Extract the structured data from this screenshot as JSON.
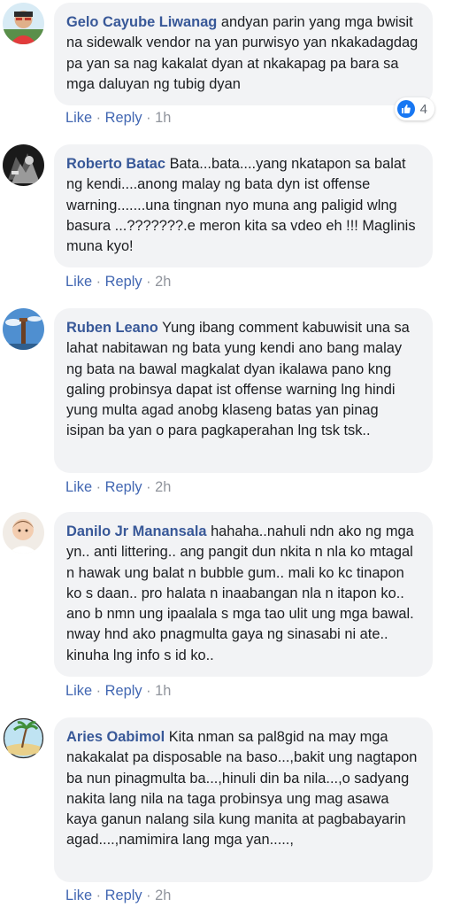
{
  "comments": [
    {
      "author": "Gelo Cayube Liwanag",
      "text": "andyan parin yang mga bwisit na sidewalk vendor na yan purwisyo yan nkakadagdag pa yan sa nag kakalat dyan at nkakapag pa bara sa mga daluyan ng tubig dyan",
      "like_label": "Like",
      "reply_label": "Reply",
      "time": "1h",
      "separator": "·",
      "reaction_count": "4",
      "reaction_icon": "thumbs-up-icon"
    },
    {
      "author": "Roberto Batac",
      "text": "Bata...bata....yang nkatapon sa balat ng kendi....anong malay ng bata dyn ist offense warning.......una tingnan nyo muna ang paligid wlng basura ...???????.e meron kita sa vdeo eh !!! Maglinis muna kyo!",
      "like_label": "Like",
      "reply_label": "Reply",
      "time": "2h",
      "separator": "·"
    },
    {
      "author": "Ruben Leano",
      "text": "Yung ibang comment kabuwisit una sa lahat nabitawan ng bata yung kendi ano bang malay ng bata na bawal magkalat dyan ikalawa pano kng galing probinsya dapat ist offense warning lng hindi yung multa agad anobg klaseng batas yan pinag isipan ba yan o para pagkaperahan lng tsk tsk..",
      "like_label": "Like",
      "reply_label": "Reply",
      "time": "2h",
      "separator": "·"
    },
    {
      "author": "Danilo Jr Manansala",
      "text": "hahaha..nahuli ndn ako ng mga yn.. anti littering.. ang pangit dun nkita n nla ko mtagal n hawak ung balat n bubble gum.. mali ko kc tinapon ko s daan.. pro halata n inaabangan nla n itapon ko.. ano b nmn ung ipaalala s mga tao ulit ung mga bawal. nway hnd ako pnagmulta gaya ng sinasabi ni ate.. kinuha lng info s id ko..",
      "like_label": "Like",
      "reply_label": "Reply",
      "time": "1h",
      "separator": "·"
    },
    {
      "author": "Aries Oabimol",
      "text": "Kita nman sa pal8gid na may mga nakakalat pa disposable na baso...,bakit ung nagtapon ba nun pinagmulta ba...,hinuli din ba nila...,o sadyang nakita lang nila na taga probinsya ung mag asawa kaya ganun nalang sila kung manita at pagbabayarin agad....,namimira lang mga yan.....,",
      "like_label": "Like",
      "reply_label": "Reply",
      "time": "2h",
      "separator": "·"
    }
  ],
  "colors": {
    "author": "#385898",
    "action_link": "#4267b2",
    "muted": "#90949c",
    "bubble_bg": "#f2f3f5",
    "like_blue": "#1877f2"
  }
}
